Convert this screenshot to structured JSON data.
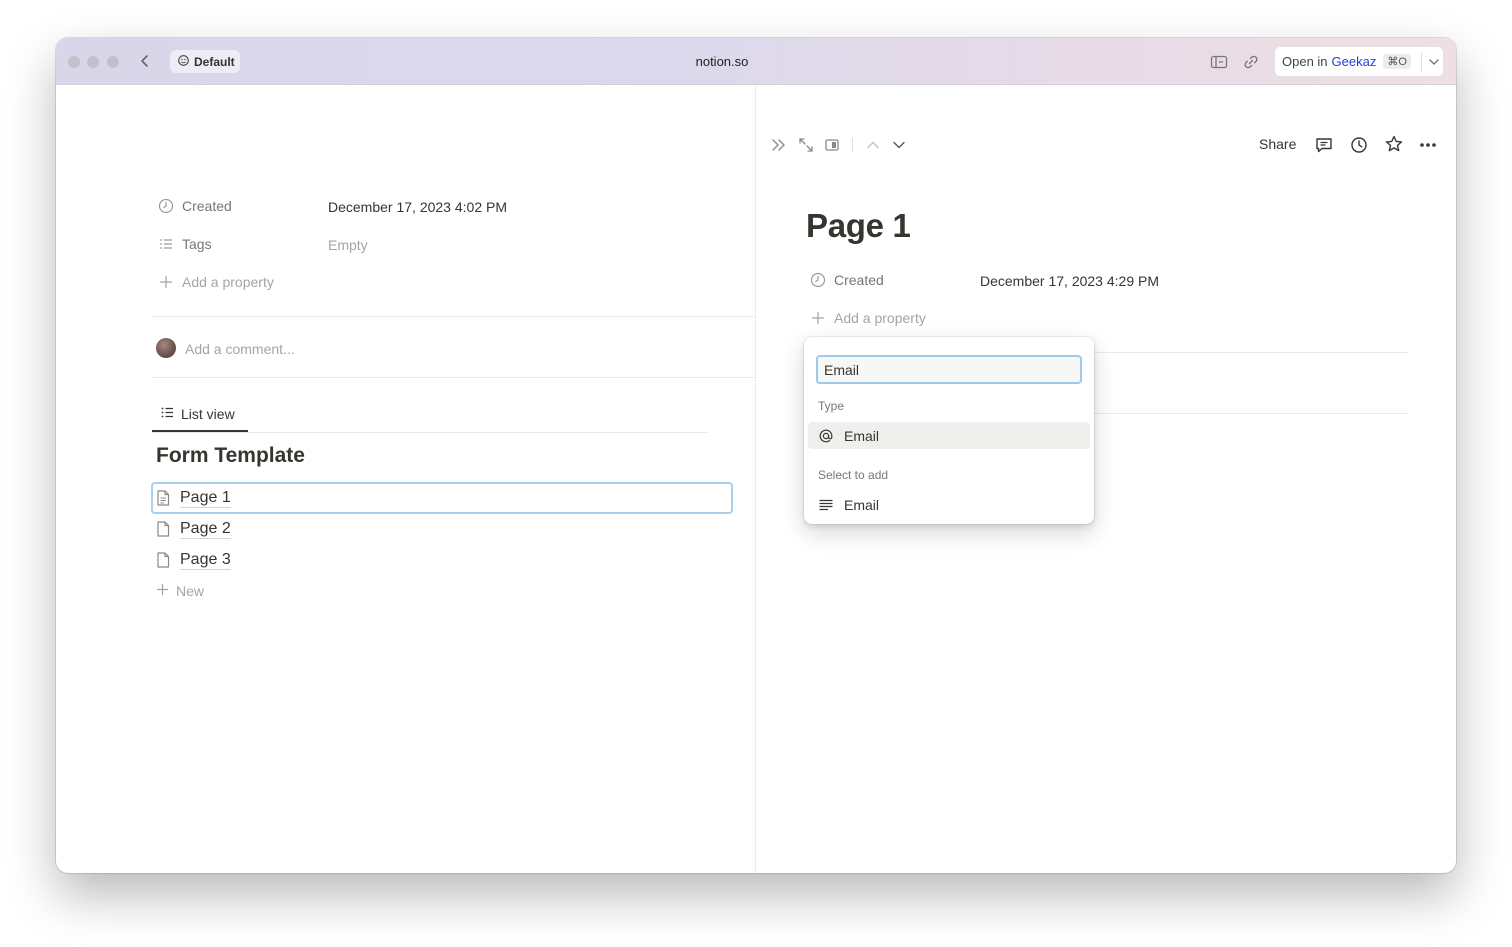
{
  "browser": {
    "profile_label": "Default",
    "url": "notion.so",
    "open_in_label": "Open in",
    "open_in_app": "Geekaz",
    "open_in_shortcut": "⌘O"
  },
  "left_page": {
    "properties": [
      {
        "icon": "clock-icon",
        "name": "Created",
        "value": "December 17, 2023 4:02 PM"
      },
      {
        "icon": "list-icon",
        "name": "Tags",
        "value": "Empty"
      }
    ],
    "add_property_label": "Add a property",
    "comment_placeholder": "Add a comment...",
    "view_tab_label": "List view",
    "database_title": "Form Template",
    "items": [
      "Page 1",
      "Page 2",
      "Page 3"
    ],
    "new_label": "New"
  },
  "right_page": {
    "share_label": "Share",
    "title": "Page 1",
    "properties": [
      {
        "icon": "clock-icon",
        "name": "Created",
        "value": "December 17, 2023 4:29 PM"
      }
    ],
    "add_property_label": "Add a property"
  },
  "property_popup": {
    "input_value": "Email",
    "type_section_label": "Type",
    "type_option": {
      "icon": "at-icon",
      "label": "Email"
    },
    "select_section_label": "Select to add",
    "select_option": {
      "icon": "text-lines-icon",
      "label": "Email"
    }
  },
  "colors": {
    "accent_focus": "#9ecaec",
    "text_primary": "#37352f",
    "text_muted": "#787774",
    "brand_link": "#2443d6"
  }
}
